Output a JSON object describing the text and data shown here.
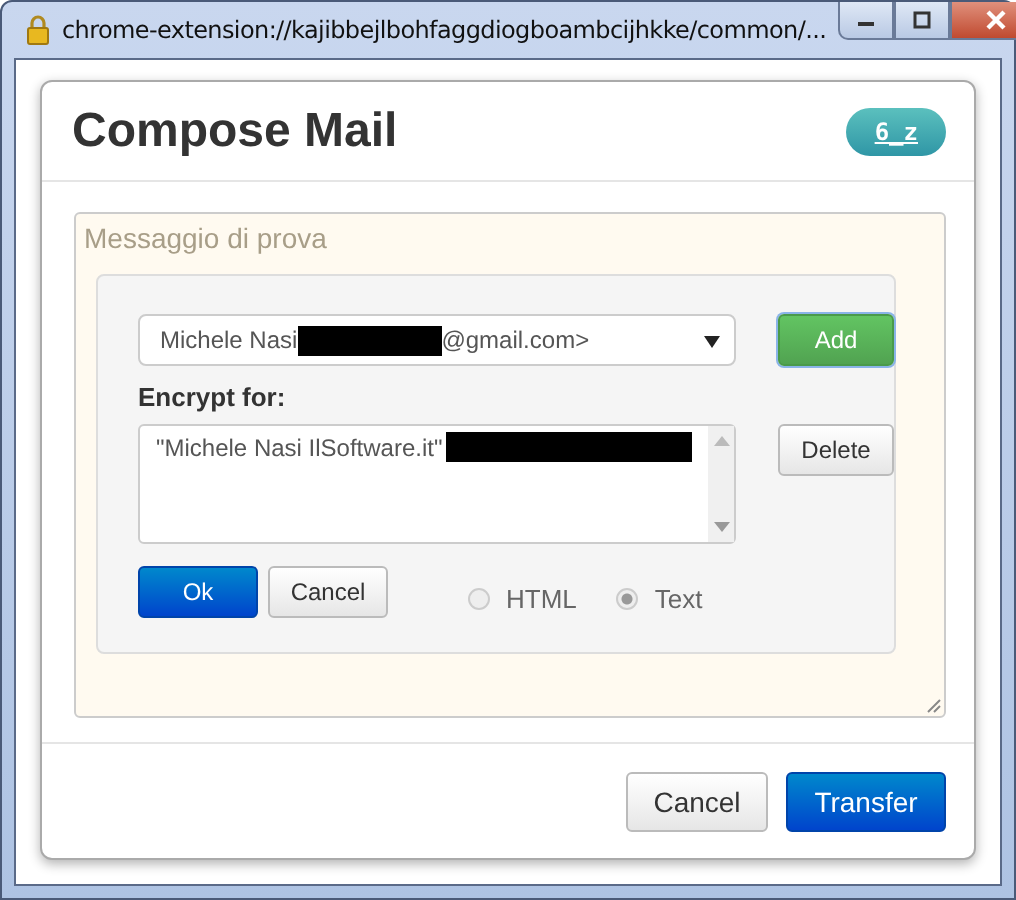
{
  "window": {
    "title": "chrome-extension://kajibbejlbohfaggdiogboambcijhkke/common/..."
  },
  "dialog": {
    "title": "Compose Mail",
    "badge": "6_z",
    "message": {
      "text": "Messaggio di prova"
    },
    "encrypt": {
      "recipient_select": {
        "value_prefix": "Michele Nasi",
        "value_suffix": "@gmail.com>"
      },
      "add_button": "Add",
      "label": "Encrypt for:",
      "recipients": [
        {
          "text": "\"Michele Nasi IlSoftware.it\"",
          "redacted": true
        }
      ],
      "delete_button": "Delete",
      "ok_button": "Ok",
      "cancel_button": "Cancel",
      "formats": [
        {
          "label": "HTML",
          "selected": false
        },
        {
          "label": "Text",
          "selected": true
        }
      ]
    },
    "buttons": [
      {
        "label": "Cancel",
        "kind": "secondary"
      },
      {
        "label": "Transfer",
        "kind": "primary"
      }
    ]
  }
}
